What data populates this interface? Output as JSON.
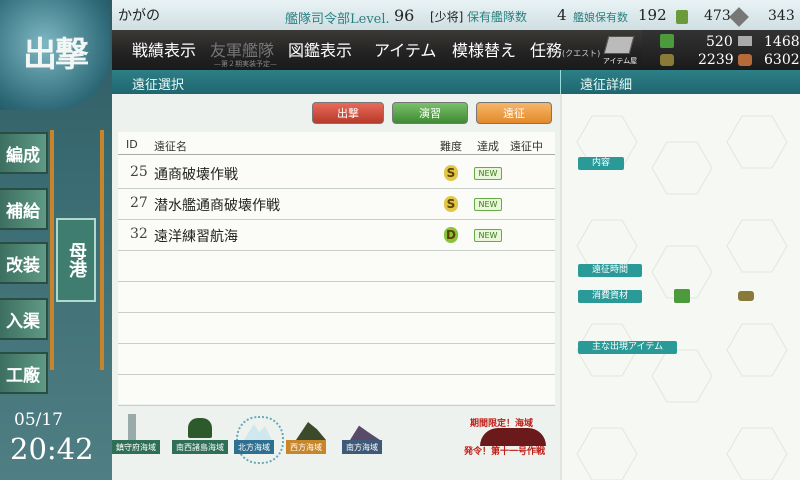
{
  "header": {
    "badge": "出撃",
    "admiral_name": "かがの",
    "level_label": "艦隊司令部Level.",
    "level": "96",
    "rank": "[少将]",
    "ships_label": "保有艦隊数",
    "ships_count": "4",
    "equip_label": "艦娘保有数",
    "equip_count": "192"
  },
  "menu": {
    "items": [
      "戦績表示",
      "友軍艦隊",
      "図鑑表示",
      "アイテム",
      "模様替え",
      "任務"
    ],
    "friend_sub": "—第２期実装予定—",
    "quest_sub": "(クエスト)",
    "item_shop_label": "アイテム屋"
  },
  "resources": {
    "fuel": "520",
    "ammo": "2239",
    "steel": "1468",
    "bauxite": "6302",
    "bucket": "473",
    "devmat": "343"
  },
  "sidebar": {
    "items": [
      "編成",
      "補給",
      "改装",
      "入渠",
      "工廠"
    ],
    "port": "母港"
  },
  "clock": {
    "date": "05/17",
    "time": "20:42"
  },
  "section": {
    "left": "遠征選択",
    "right": "遠征詳細"
  },
  "modes": {
    "sortie": "出撃",
    "practice": "演習",
    "expedition": "遠征"
  },
  "table": {
    "headers": {
      "id": "ID",
      "name": "遠征名",
      "difficulty": "難度",
      "achieved": "達成",
      "ongoing": "遠征中"
    },
    "rows": [
      {
        "id": "25",
        "name": "通商破壊作戦",
        "difficulty": "S",
        "badge": "NEW"
      },
      {
        "id": "27",
        "name": "潜水艦通商破壊作戦",
        "difficulty": "S",
        "badge": "NEW"
      },
      {
        "id": "32",
        "name": "遠洋練習航海",
        "difficulty": "D",
        "badge": "NEW"
      }
    ]
  },
  "detail": {
    "content_label": "内容",
    "time_label": "遠征時間",
    "supplies_label": "消費資材",
    "items_label": "主な出現アイテム"
  },
  "worlds": {
    "tabs": [
      "鎮守府海域",
      "南西諸島海域",
      "北方海域",
      "西方海域",
      "南方海域"
    ],
    "event_title": "期間限定！海域",
    "event_sub": "発令！第十一号作戦"
  },
  "colors": {
    "teal": "#2a9a98",
    "menu_bg": "#222222",
    "section_bg": "#1f6770",
    "diff_S": "#e2c64a",
    "diff_D": "#8ac43c"
  }
}
